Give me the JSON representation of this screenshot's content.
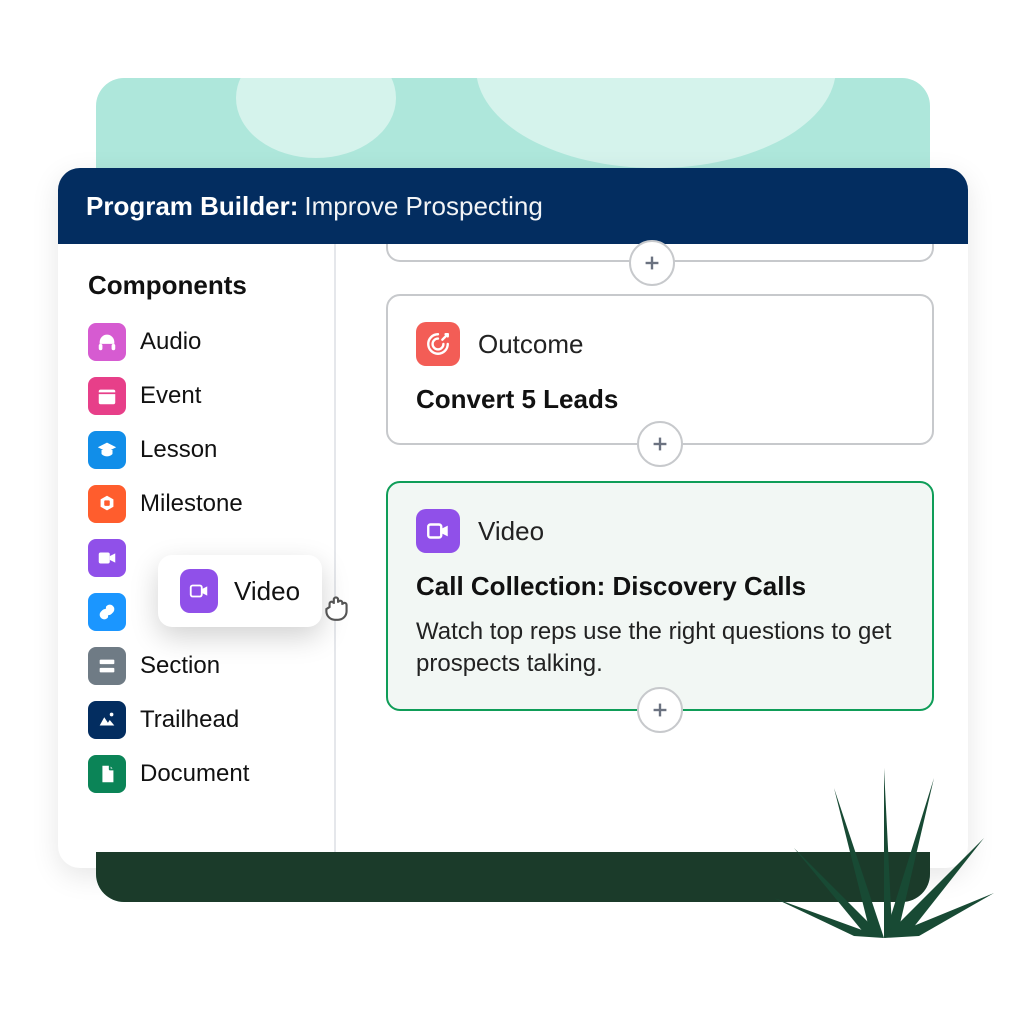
{
  "header": {
    "title": "Program Builder:",
    "subtitle": "Improve Prospecting"
  },
  "sidebar": {
    "heading": "Components",
    "items": [
      {
        "key": "audio",
        "label": "Audio",
        "icon": "headphones",
        "color": "#d65bd1"
      },
      {
        "key": "event",
        "label": "Event",
        "icon": "calendar",
        "color": "#e73f89"
      },
      {
        "key": "lesson",
        "label": "Lesson",
        "icon": "grad-cap",
        "color": "#118ee9"
      },
      {
        "key": "milestone",
        "label": "Milestone",
        "icon": "flag-hex",
        "color": "#ff5d2d"
      },
      {
        "key": "video",
        "label": "Video",
        "icon": "video",
        "color": "#9050e9",
        "label_hidden": true
      },
      {
        "key": "link",
        "label": "Link",
        "icon": "link",
        "color": "#1b96ff",
        "label_hidden": true
      },
      {
        "key": "section",
        "label": "Section",
        "icon": "section",
        "color": "#6f7b85"
      },
      {
        "key": "trailhead",
        "label": "Trailhead",
        "icon": "trailhead",
        "color": "#032d60"
      },
      {
        "key": "document",
        "label": "Document",
        "icon": "document",
        "color": "#0b8457"
      }
    ]
  },
  "drag": {
    "label": "Video",
    "icon": "video",
    "color": "#9050e9"
  },
  "canvas": {
    "cards": [
      {
        "kind": "Outcome",
        "title": "Convert 5 Leads",
        "icon": "target",
        "color": "#f35d56",
        "selected": false
      },
      {
        "kind": "Video",
        "title": "Call Collection: Discovery Calls",
        "desc": "Watch top reps use the right questions to get prospects talking.",
        "icon": "video",
        "color": "#9050e9",
        "selected": true
      }
    ]
  },
  "colors": {
    "headerBg": "#032d60",
    "selectedBorder": "#0f9d58"
  }
}
